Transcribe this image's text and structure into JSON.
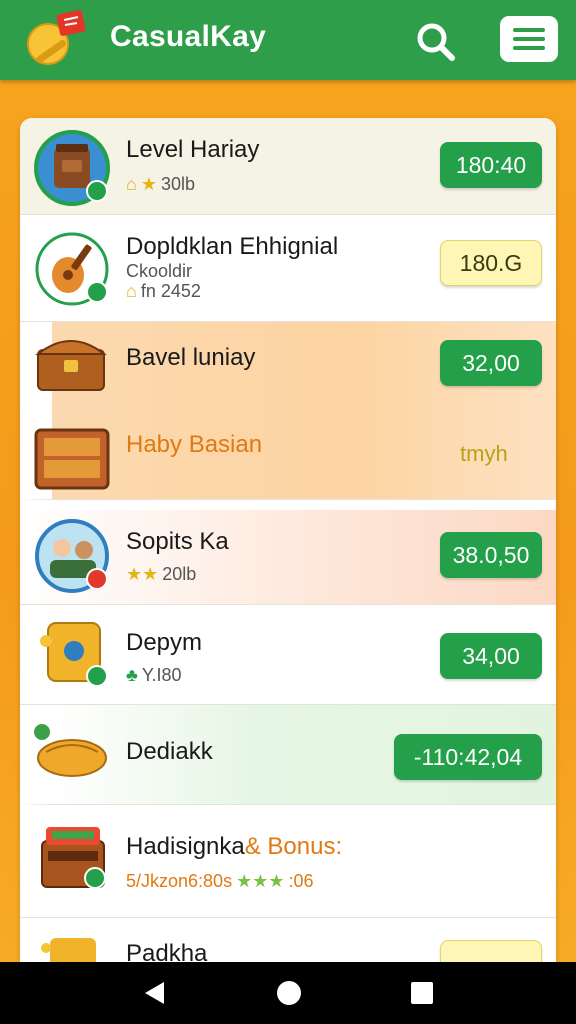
{
  "app": {
    "title": "CasualKay",
    "colors": {
      "appbar": "#2e9e4b",
      "accent_green": "#23a049",
      "background_orange": "#f59a1b"
    }
  },
  "header": {
    "search_icon": "search-icon",
    "menu_icon": "hamburger-menu-icon"
  },
  "items": [
    {
      "title": "Level Hariay",
      "sub": "30lb",
      "icon": "jar-icon",
      "price": "180:40"
    },
    {
      "title": "Dopldklan Ehhignial",
      "sub_line1": "Ckooldir",
      "sub": "fn 2452",
      "icon": "guitar-icon",
      "price": "180.G"
    },
    {
      "title": "Bavel luniay",
      "icon": "treasure-chest-icon",
      "price": "32,00"
    },
    {
      "title": "Haby Basian",
      "icon": "crate-icon",
      "price": "tmyh"
    },
    {
      "title": "Sopits Ka",
      "sub": "20lb",
      "icon": "people-icon",
      "price": "38.0,50"
    },
    {
      "title": "Depym",
      "sub": "Y.I80",
      "icon": "map-icon",
      "price": "34,00"
    },
    {
      "title": "Dediakk",
      "icon": "bread-icon",
      "price": "-110:42,04"
    },
    {
      "title": "Hadisignka",
      "title_bonus": "& Bonus:",
      "sub": "5/Jkzon6:80s",
      "sub_tail": ":06",
      "icon": "bonus-chest-icon",
      "price": ""
    },
    {
      "title": "Padkha",
      "icon": "puzzle-icon",
      "price": ""
    }
  ],
  "nav": {
    "back_icon": "back-triangle-icon",
    "home_icon": "home-circle-icon",
    "recents_icon": "recents-square-icon"
  }
}
